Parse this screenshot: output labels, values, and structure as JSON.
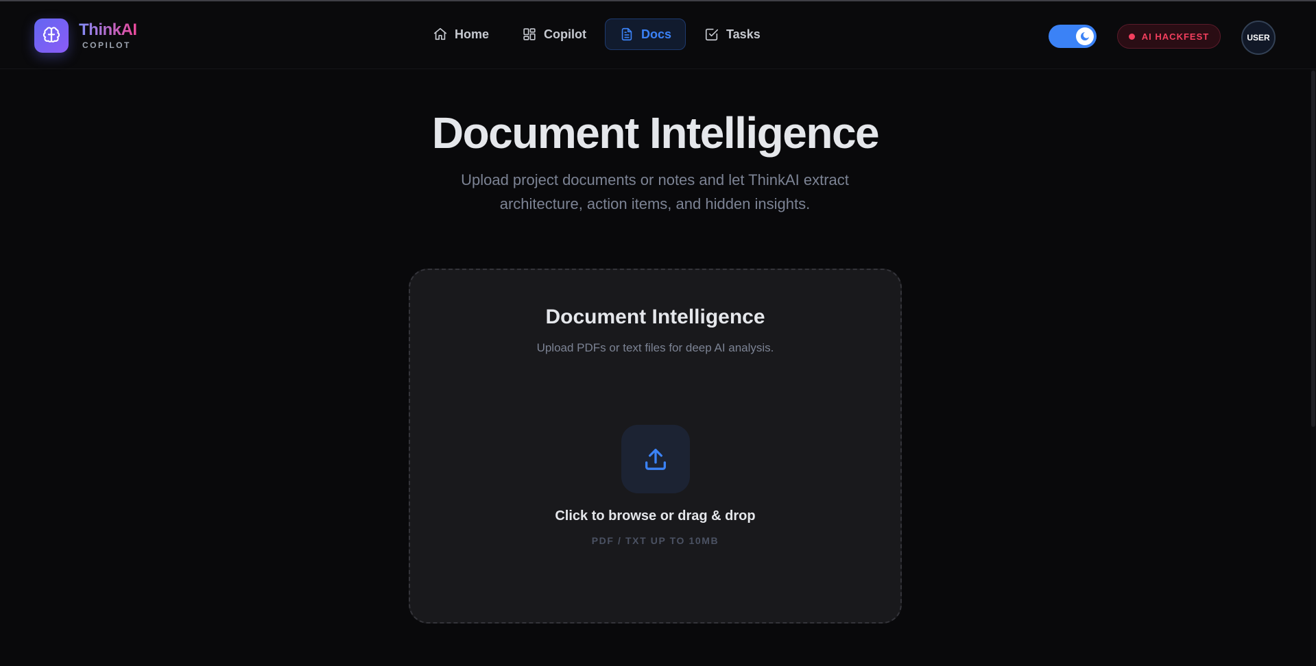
{
  "brand": {
    "name": "ThinkAI",
    "subtitle": "COPILOT",
    "logo_icon": "brain-icon"
  },
  "nav": {
    "items": [
      {
        "label": "Home",
        "icon": "home-icon",
        "active": false
      },
      {
        "label": "Copilot",
        "icon": "grid-icon",
        "active": false
      },
      {
        "label": "Docs",
        "icon": "document-icon",
        "active": true
      },
      {
        "label": "Tasks",
        "icon": "checkbox-icon",
        "active": false
      }
    ]
  },
  "header_right": {
    "theme_toggle": {
      "on": true,
      "icon": "moon-icon"
    },
    "badge": "AI HACKFEST",
    "avatar": "USER"
  },
  "hero": {
    "title": "Document Intelligence",
    "subtitle": "Upload project documents or notes and let ThinkAI extract architecture, action items, and hidden insights."
  },
  "upload_card": {
    "title": "Document Intelligence",
    "subtitle": "Upload PDFs or text files for deep AI analysis.",
    "icon": "upload-icon",
    "cta": "Click to browse or drag & drop",
    "meta": "PDF / TXT UP TO 10MB"
  },
  "colors": {
    "background": "#09090b",
    "accent": "#3b82f6",
    "badge": "#f43f5e",
    "brand_gradient_start": "#818cf8",
    "brand_gradient_end": "#ec4899"
  }
}
